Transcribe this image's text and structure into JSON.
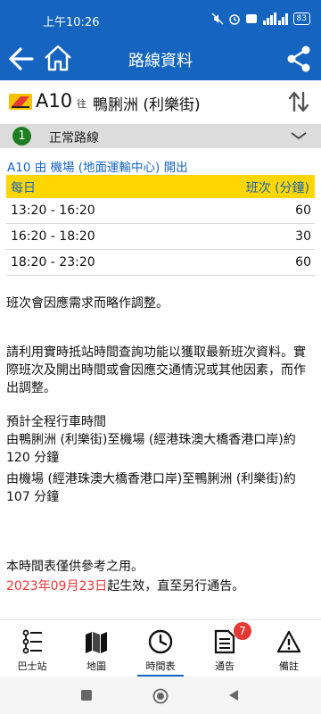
{
  "status": {
    "time": "上午10:26",
    "battery": "83"
  },
  "appbar": {
    "title": "路線資料"
  },
  "route": {
    "number": "A10",
    "to_label": "往",
    "destination": "鴨脷洲 (利樂街)"
  },
  "service": {
    "number": "1",
    "label": "正常路線"
  },
  "timetable": {
    "origin_text": "A10 由 機場 (地面運輸中心) 開出",
    "header": {
      "day": "每日",
      "freq": "班次 (分鐘)"
    },
    "rows": [
      {
        "period": "13:20 - 16:20",
        "freq": "60"
      },
      {
        "period": "16:20 - 18:20",
        "freq": "30"
      },
      {
        "period": "18:20 - 23:20",
        "freq": "60"
      }
    ]
  },
  "notes": {
    "adjust": "班次會因應需求而略作調整。",
    "realtime": "請利用實時抵站時間查詢功能以獲取最新班次資料。實際班次及開出時間或會因應交通情況或其他因素，而作出調整。",
    "journey_title": "預計全程行車時間",
    "journey_1": "由鴨脷洲 (利樂街)至機場 (經港珠澳大橋香港口岸)約 120 分鐘",
    "journey_2": "由機場 (經港珠澳大橋香港口岸)至鴨脷洲 (利樂街)約 107 分鐘",
    "reference": "本時間表僅供參考之用。",
    "effective_date": "2023年09月23日",
    "effective_rest": "起生效，直至另行通告。"
  },
  "nav": {
    "items": [
      {
        "label": "巴士站"
      },
      {
        "label": "地圖"
      },
      {
        "label": "時間表"
      },
      {
        "label": "通告",
        "badge": "7"
      },
      {
        "label": "備註"
      }
    ]
  },
  "colors": {
    "primary": "#1565c0",
    "accent": "#ffd600",
    "highlight": "#e53935",
    "service": "#1e7d23"
  }
}
